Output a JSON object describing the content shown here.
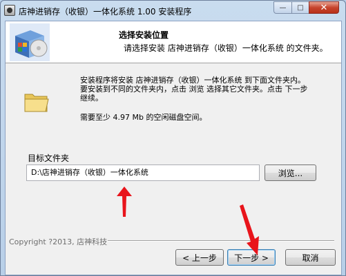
{
  "window": {
    "title": "店神进销存（收银）一体化系统 1.00 安装程序",
    "min_glyph": "—",
    "max_glyph": "□",
    "close_glyph": "✕"
  },
  "header": {
    "title": "选择安装位置",
    "subtitle": "请选择安装 店神进销存（收银）一体化系统 的文件夹。"
  },
  "body": {
    "line1": "安装程序将安装 店神进销存（收银）一体化系统 到下面文件夹内。",
    "line2": "要安装到不同的文件夹内，点击 浏览 选择其它文件夹。点击 下一步",
    "line3": "继续。",
    "space_required": "需要至少 4.97 Mb 的空闲磁盘空间。"
  },
  "destination": {
    "label": "目标文件夹",
    "path": "D:\\店神进销存（收银）一体化系统",
    "browse_label": "浏览..."
  },
  "footer": {
    "copyright": "Copyright ?2013, 店神科技",
    "back_label": "< 上一步",
    "next_label": "下一步 >",
    "cancel_label": "取消"
  },
  "icons": [
    "installer-box-icon",
    "folder-icon",
    "app-icon"
  ],
  "annotation_color": "#e8141b"
}
